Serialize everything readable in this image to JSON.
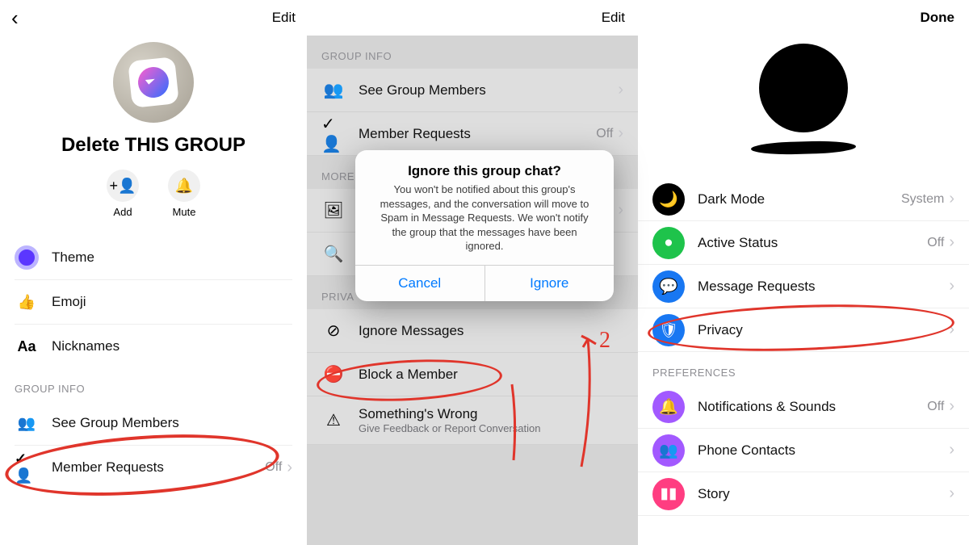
{
  "panel1": {
    "edit": "Edit",
    "group_title": "Delete THIS GROUP",
    "actions": {
      "add": "Add",
      "mute": "Mute"
    },
    "theme": "Theme",
    "emoji": "Emoji",
    "nicknames": "Nicknames",
    "section_group_info": "GROUP INFO",
    "see_members": "See Group Members",
    "member_requests": "Member Requests",
    "member_requests_value": "Off"
  },
  "panel2": {
    "edit": "Edit",
    "section_group_info": "GROUP INFO",
    "see_members": "See Group Members",
    "member_requests": "Member Requests",
    "member_requests_value": "Off",
    "section_more": "MORE",
    "section_privacy": "PRIVA",
    "ignore_messages": "Ignore Messages",
    "block_member": "Block a Member",
    "wrong_title": "Something's Wrong",
    "wrong_sub": "Give Feedback or Report Conversation",
    "modal": {
      "title": "Ignore this group chat?",
      "body": "You won't be notified about this group's messages, and the conversation will move to Spam in Message Requests. We won't notify the group that the messages have been ignored.",
      "cancel": "Cancel",
      "ignore": "Ignore"
    }
  },
  "panel3": {
    "done": "Done",
    "dark_mode": "Dark Mode",
    "dark_mode_value": "System",
    "active_status": "Active Status",
    "active_status_value": "Off",
    "message_requests": "Message Requests",
    "privacy": "Privacy",
    "section_prefs": "PREFERENCES",
    "notifications": "Notifications & Sounds",
    "notifications_value": "Off",
    "phone_contacts": "Phone Contacts",
    "story": "Story"
  }
}
